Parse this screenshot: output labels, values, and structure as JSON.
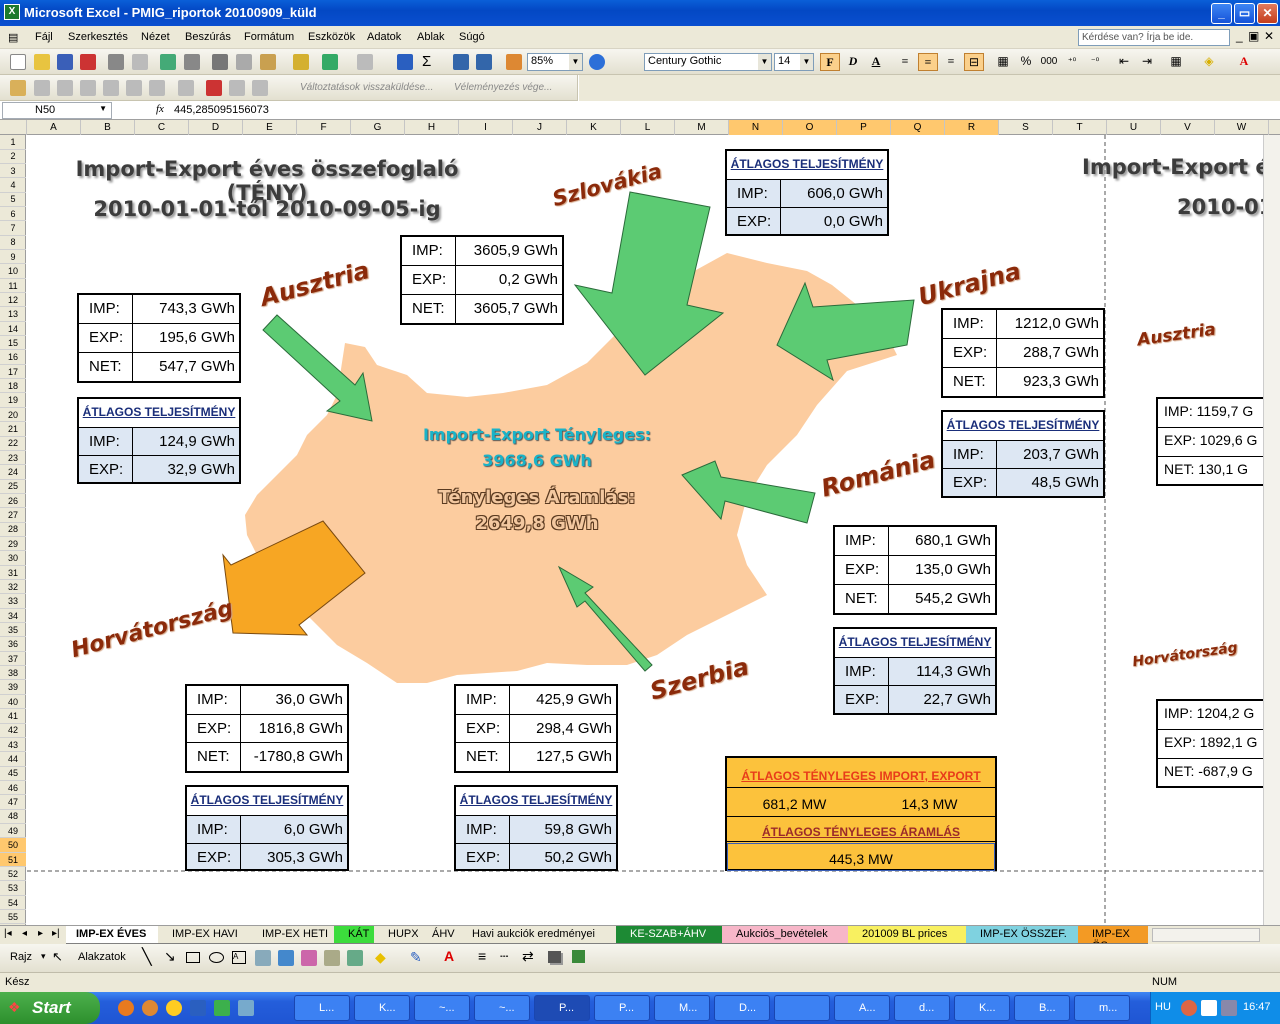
{
  "window": {
    "title": "Microsoft Excel - PMIG_riportok 20100909_küld"
  },
  "menu": {
    "items": [
      "Fájl",
      "Szerkesztés",
      "Nézet",
      "Beszúrás",
      "Formátum",
      "Eszközök",
      "Adatok",
      "Ablak",
      "Súgó"
    ],
    "help_placeholder": "Kérdése van? Írja be ide."
  },
  "toolbar": {
    "zoom": "85%",
    "font": "Century Gothic",
    "font_size": "14",
    "review_text": "Változtatások visszaküldése...",
    "review_end": "Véleményezés vége..."
  },
  "formula_bar": {
    "name_box": "N50",
    "fx": "fx",
    "formula": "445,285095156073"
  },
  "columns": [
    "A",
    "B",
    "C",
    "D",
    "E",
    "F",
    "G",
    "H",
    "I",
    "J",
    "K",
    "L",
    "M",
    "N",
    "O",
    "P",
    "Q",
    "R",
    "S",
    "T",
    "U",
    "V",
    "W"
  ],
  "rows": [
    "1",
    "2",
    "3",
    "4",
    "5",
    "6",
    "7",
    "8",
    "9",
    "10",
    "11",
    "12",
    "13",
    "14",
    "15",
    "16",
    "17",
    "18",
    "19",
    "20",
    "21",
    "22",
    "23",
    "24",
    "25",
    "26",
    "27",
    "28",
    "29",
    "30",
    "31",
    "32",
    "33",
    "34",
    "35",
    "36",
    "37",
    "38",
    "39",
    "40",
    "41",
    "42",
    "43",
    "44",
    "45",
    "46",
    "47",
    "48",
    "49",
    "50",
    "51",
    "52",
    "53",
    "54",
    "55"
  ],
  "report": {
    "title1": "Import-Export éves összefoglaló (TÉNY)",
    "title2": "2010-01-01-től 2010-09-05-ig",
    "center_label1": "Import-Export Tényleges:",
    "center_value1": "3968,6 GWh",
    "center_label2": "Tényleges Áramlás:",
    "center_value2": "2649,8 GWh",
    "avg_header": "ÁTLAGOS TELJESÍTMÉNY",
    "imp": "IMP:",
    "exp": "EXP:",
    "net": "NET:",
    "countries": {
      "austria": {
        "name": "Ausztria",
        "imp": "743,3 GWh",
        "exp": "195,6 GWh",
        "net": "547,7 GWh",
        "avg_imp": "124,9 GWh",
        "avg_exp": "32,9 GWh"
      },
      "slovakia": {
        "name": "Szlovákia",
        "imp": "3605,9 GWh",
        "exp": "0,2 GWh",
        "net": "3605,7 GWh",
        "avg_imp": "606,0 GWh",
        "avg_exp": "0,0 GWh"
      },
      "ukraine": {
        "name": "Ukrajna",
        "imp": "1212,0 GWh",
        "exp": "288,7 GWh",
        "net": "923,3 GWh",
        "avg_imp": "203,7 GWh",
        "avg_exp": "48,5 GWh"
      },
      "romania": {
        "name": "Románia",
        "imp": "680,1 GWh",
        "exp": "135,0 GWh",
        "net": "545,2 GWh",
        "avg_imp": "114,3 GWh",
        "avg_exp": "22,7 GWh"
      },
      "serbia": {
        "name": "Szerbia",
        "imp": "425,9 GWh",
        "exp": "298,4 GWh",
        "net": "127,5 GWh",
        "avg_imp": "59,8 GWh",
        "avg_exp": "50,2 GWh"
      },
      "croatia": {
        "name": "Horvátország",
        "imp": "36,0 GWh",
        "exp": "1816,8 GWh",
        "net": "-1780,8 GWh",
        "avg_imp": "6,0 GWh",
        "avg_exp": "305,3 GWh"
      }
    },
    "summary": {
      "header1": "ÁTLAGOS TÉNYLEGES IMPORT, EXPORT",
      "import_mw": "681,2 MW",
      "export_mw": "14,3 MW",
      "header2": "ÁTLAGOS TÉNYLEGES ÁRAMLÁS",
      "flow_mw": "445,3 MW"
    },
    "right": {
      "title1": "Import-Export év",
      "title2": "2010-01",
      "austria": "Ausztria",
      "croatia": "Horvátország",
      "a_imp": "IMP:  1159,7 G",
      "a_exp": "EXP:  1029,6 G",
      "a_net": "NET:  130,1 G",
      "c_imp": "IMP:  1204,2 G",
      "c_exp": "EXP:  1892,1 G",
      "c_net": "NET:  -687,9 G"
    }
  },
  "sheet_tabs": [
    "IMP-EX ÉVES",
    "IMP-EX HAVI",
    "IMP-EX HETI",
    "KÁT",
    "HUPX",
    "ÁHV",
    "Havi aukciók eredményei",
    "KE-SZAB+ÁHV",
    "Aukciós_bevételek",
    "201009 BL prices",
    "IMP-EX ÖSSZEF.",
    "IMP-EX ÖS"
  ],
  "drawing": {
    "draw": "Rajz",
    "autoshapes": "Alakzatok"
  },
  "status": {
    "ready": "Kész",
    "num": "NUM"
  },
  "taskbar": {
    "start": "Start",
    "items": [
      "L...",
      "K...",
      "~...",
      "~...",
      "P...",
      "P...",
      "M...",
      "D...",
      "",
      "A...",
      "d...",
      "K...",
      "B...",
      "m..."
    ],
    "lang": "HU",
    "clock": "16:47"
  }
}
